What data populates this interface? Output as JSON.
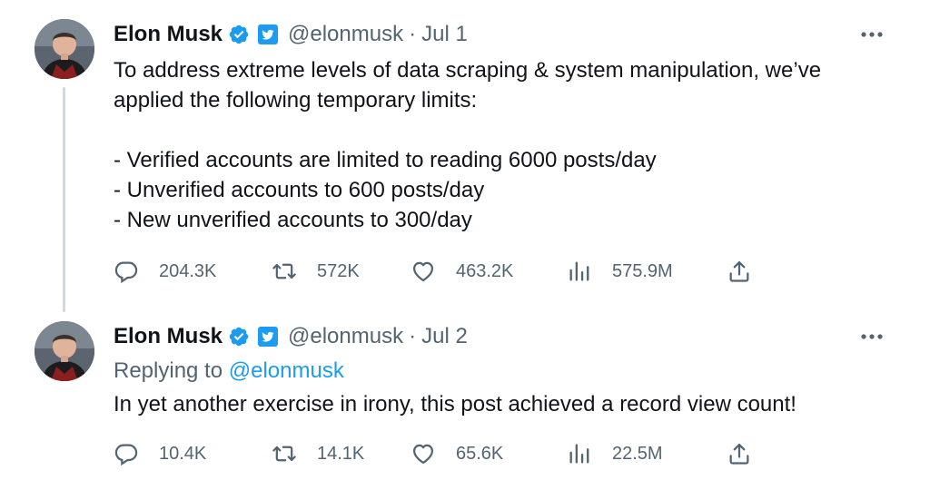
{
  "tweets": [
    {
      "author_name": "Elon Musk",
      "handle": "@elonmusk",
      "separator": "·",
      "date": "Jul 1",
      "text": "To address extreme levels of data scraping & system manipulation, we’ve applied the following temporary limits:\n\n- Verified accounts are limited to reading 6000 posts/day\n- Unverified accounts to 600 posts/day\n- New unverified accounts to 300/day",
      "stats": {
        "replies": "204.3K",
        "retweets": "572K",
        "likes": "463.2K",
        "views": "575.9M"
      }
    },
    {
      "author_name": "Elon Musk",
      "handle": "@elonmusk",
      "separator": "·",
      "date": "Jul 2",
      "replying_label": "Replying to",
      "replying_to": "@elonmusk",
      "text": "In yet another exercise in irony, this post achieved a record view count!",
      "stats": {
        "replies": "10.4K",
        "retweets": "14.1K",
        "likes": "65.6K",
        "views": "22.5M"
      }
    }
  ],
  "icons": {
    "verified": "verified-check-icon",
    "org_badge": "twitter-org-badge-icon",
    "more": "more-dots-icon",
    "reply": "reply-bubble-icon",
    "retweet": "retweet-arrows-icon",
    "like": "heart-icon",
    "views": "views-bars-icon",
    "share": "share-upload-icon"
  },
  "colors": {
    "verified_blue": "#1d9bf0",
    "secondary_text": "#536471",
    "primary_text": "#0f1419",
    "thread_line": "#cfd9de"
  }
}
